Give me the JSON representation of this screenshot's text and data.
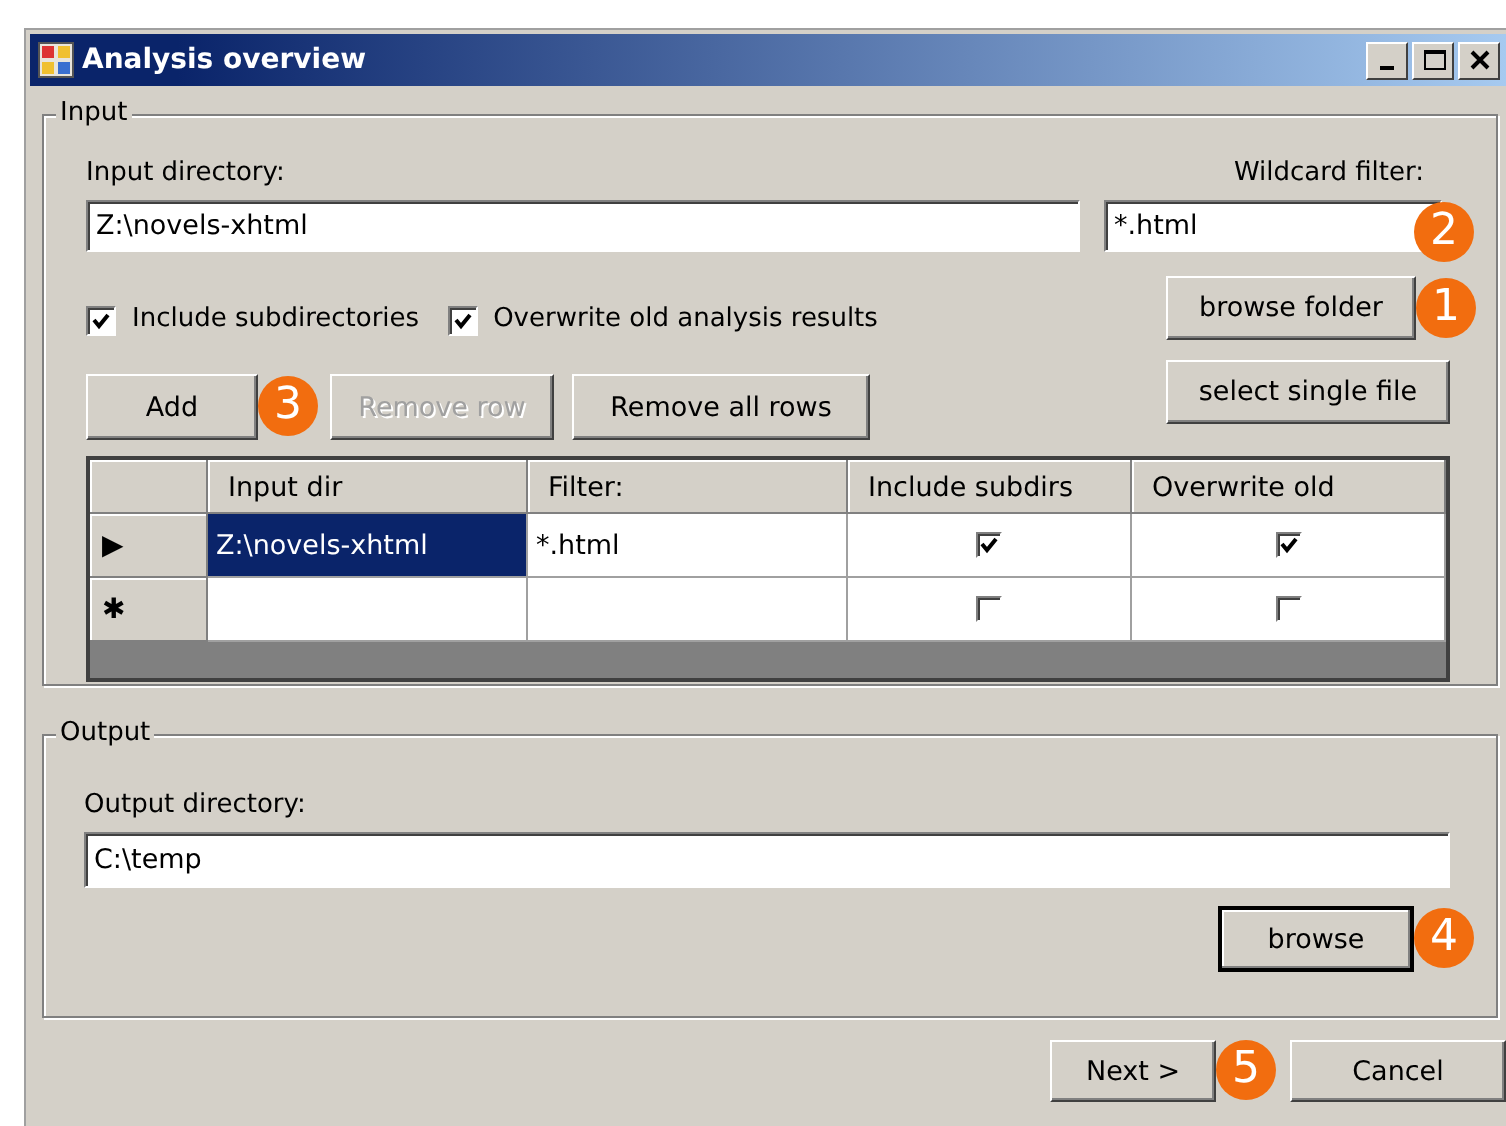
{
  "window": {
    "title": "Analysis overview"
  },
  "input": {
    "legend": "Input",
    "directory_label": "Input directory:",
    "directory_value": "Z:\\novels-xhtml",
    "filter_label": "Wildcard filter:",
    "filter_value": "*.html",
    "filter_badge": "2",
    "options": [
      {
        "label": "Include subdirectories",
        "checked": true
      },
      {
        "label": "Overwrite old analysis results",
        "checked": true
      }
    ],
    "buttons": [
      {
        "label": "Add",
        "disabled": false,
        "badge": "3"
      },
      {
        "label": "Remove row",
        "disabled": true
      },
      {
        "label": "Remove all rows",
        "disabled": false
      }
    ],
    "side_buttons": [
      {
        "label": "browse folder",
        "badge": "1"
      },
      {
        "label": "select single file"
      }
    ],
    "grid": {
      "columns": [
        "Input dir",
        "Filter:",
        "Include subdirs",
        "Overwrite old"
      ],
      "rows": [
        {
          "marker": "▶",
          "input_dir": "Z:\\novels-xhtml",
          "filter": "*.html",
          "include_subdirs": true,
          "overwrite_old": true,
          "selected": true
        },
        {
          "marker": "✱",
          "include_subdirs": false,
          "overwrite_old": false,
          "selected": false
        }
      ]
    }
  },
  "output": {
    "legend": "Output",
    "directory_label": "Output directory:",
    "directory_value": "C:\\temp",
    "button": {
      "label": "browse",
      "badge": "4",
      "focused": true
    }
  },
  "footer": {
    "buttons": [
      {
        "label": "Next >",
        "badge": "5"
      },
      {
        "label": "Cancel"
      }
    ]
  }
}
